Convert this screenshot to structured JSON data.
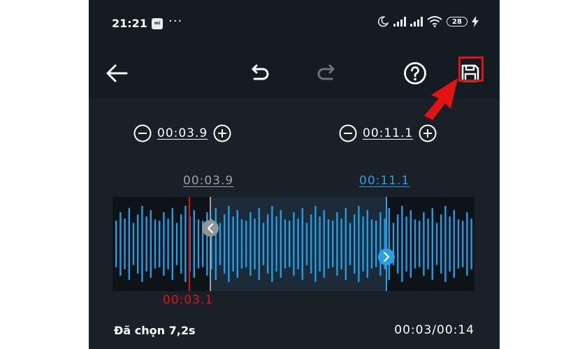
{
  "status_bar": {
    "time": "21:21",
    "app_icon_text": "mi",
    "more": "···",
    "battery": "28"
  },
  "toolbar": {
    "back_icon": "arrow-left-icon",
    "undo_icon": "undo-icon",
    "redo_icon": "redo-icon",
    "help_icon": "help-circle-icon",
    "save_icon": "save-floppy-icon"
  },
  "trim": {
    "start": "00:03.9",
    "end": "00:11.1",
    "start_marker": "00:03.9",
    "end_marker": "00:11.1",
    "playhead": "00:03.1"
  },
  "footer": {
    "selected": "Đã chọn 7,2s",
    "progress": "00:03/00:14"
  },
  "colors": {
    "background": "#1a2027",
    "bar": "#151b22",
    "wave": "#1e9ee6",
    "accent": "#2b9fe6",
    "marker_start": "#9aa3ab",
    "playhead": "#e21313",
    "highlight": "#e21313"
  }
}
